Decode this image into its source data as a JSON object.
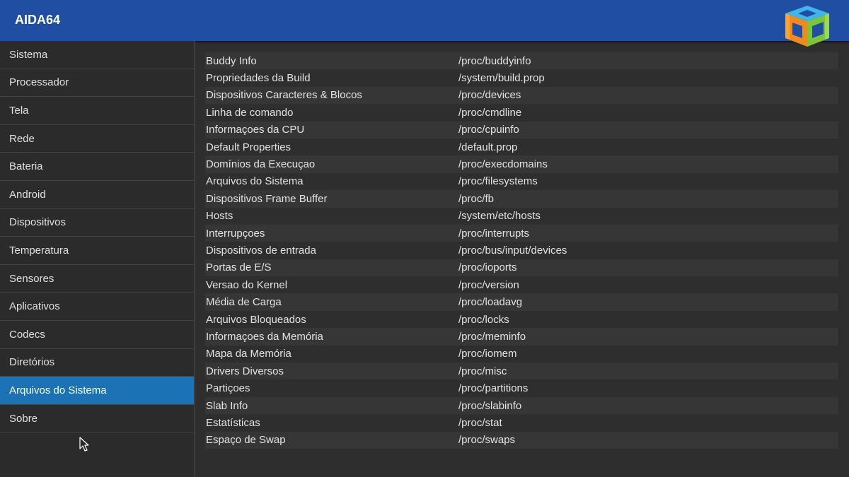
{
  "app": {
    "title": "AIDA64"
  },
  "colors": {
    "header": "#1f4ea3",
    "selected": "#1b72b5",
    "background": "#2e2e2e"
  },
  "sidebar": {
    "items": [
      {
        "label": "Sistema"
      },
      {
        "label": "Processador"
      },
      {
        "label": "Tela"
      },
      {
        "label": "Rede"
      },
      {
        "label": "Bateria"
      },
      {
        "label": "Android"
      },
      {
        "label": "Dispositivos"
      },
      {
        "label": "Temperatura"
      },
      {
        "label": "Sensores"
      },
      {
        "label": "Aplicativos"
      },
      {
        "label": "Codecs"
      },
      {
        "label": "Diretórios"
      },
      {
        "label": "Arquivos do Sistema",
        "selected": true
      },
      {
        "label": "Sobre"
      }
    ]
  },
  "main": {
    "rows": [
      {
        "name": "Buddy Info",
        "path": "/proc/buddyinfo"
      },
      {
        "name": "Propriedades da Build",
        "path": "/system/build.prop"
      },
      {
        "name": "Dispositivos Caracteres & Blocos",
        "path": "/proc/devices"
      },
      {
        "name": "Linha de comando",
        "path": "/proc/cmdline"
      },
      {
        "name": "Informaçoes da CPU",
        "path": "/proc/cpuinfo"
      },
      {
        "name": "Default Properties",
        "path": "/default.prop"
      },
      {
        "name": "Domínios da Execuçao",
        "path": "/proc/execdomains"
      },
      {
        "name": "Arquivos do Sistema",
        "path": "/proc/filesystems"
      },
      {
        "name": "Dispositivos Frame Buffer",
        "path": "/proc/fb"
      },
      {
        "name": "Hosts",
        "path": "/system/etc/hosts"
      },
      {
        "name": "Interrupçoes",
        "path": "/proc/interrupts"
      },
      {
        "name": "Dispositivos de entrada",
        "path": "/proc/bus/input/devices"
      },
      {
        "name": "Portas de E/S",
        "path": "/proc/ioports"
      },
      {
        "name": "Versao do Kernel",
        "path": "/proc/version"
      },
      {
        "name": "Média de Carga",
        "path": "/proc/loadavg"
      },
      {
        "name": "Arquivos Bloqueados",
        "path": "/proc/locks"
      },
      {
        "name": "Informaçoes da Memória",
        "path": "/proc/meminfo"
      },
      {
        "name": "Mapa da Memória",
        "path": "/proc/iomem"
      },
      {
        "name": "Drivers Diversos",
        "path": "/proc/misc"
      },
      {
        "name": "Partiçoes",
        "path": "/proc/partitions"
      },
      {
        "name": "Slab Info",
        "path": "/proc/slabinfo"
      },
      {
        "name": "Estatísticas",
        "path": "/proc/stat"
      },
      {
        "name": "Espaço de Swap",
        "path": "/proc/swaps"
      }
    ]
  },
  "icons": {
    "logo": "aida64-cube-logo-icon",
    "cursor": "mouse-pointer-icon"
  }
}
